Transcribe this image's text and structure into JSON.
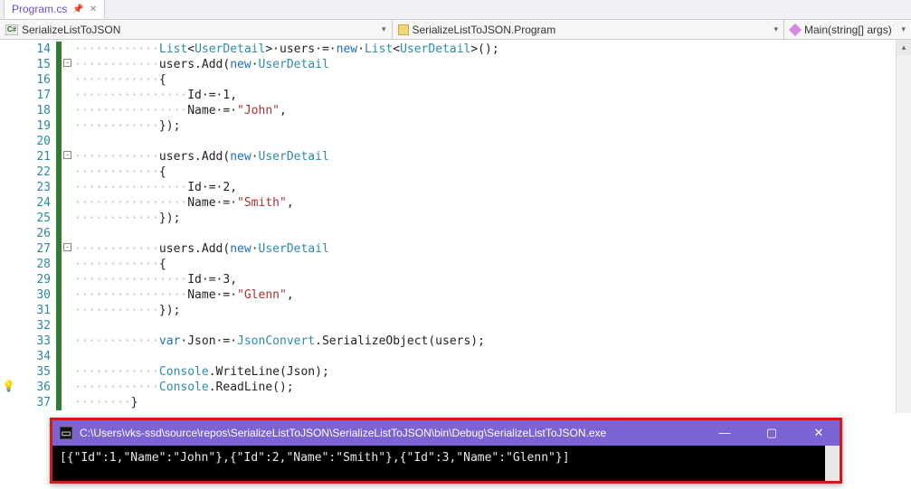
{
  "tab": {
    "filename": "Program.cs"
  },
  "context": {
    "namespace": "SerializeListToJSON",
    "class": "SerializeListToJSON.Program",
    "method": "Main(string[] args)"
  },
  "line_numbers": [
    "14",
    "15",
    "16",
    "17",
    "18",
    "19",
    "20",
    "21",
    "22",
    "23",
    "24",
    "25",
    "26",
    "27",
    "28",
    "29",
    "30",
    "31",
    "32",
    "33",
    "34",
    "35",
    "36",
    "37"
  ],
  "fold_lines": {
    "15": "-",
    "21": "-",
    "27": "-"
  },
  "lightbulb_line": "36",
  "code": {
    "l14": {
      "dots": "············",
      "a": "List",
      "b": "<",
      "c": "UserDetail",
      "d": ">·users·=·",
      "e": "new",
      "f": "·",
      "g": "List",
      "h": "<",
      "i": "UserDetail",
      "j": ">();"
    },
    "l15": {
      "dots": "············",
      "a": "users.Add(",
      "b": "new",
      "c": "·",
      "d": "UserDetail"
    },
    "l16": {
      "dots": "············",
      "a": "{"
    },
    "l17": {
      "dots": "················",
      "a": "Id·=·1,"
    },
    "l18": {
      "dots": "················",
      "a": "Name·=·",
      "b": "\"John\"",
      "c": ","
    },
    "l19": {
      "dots": "············",
      "a": "});"
    },
    "l20": {
      "dots": ""
    },
    "l21": {
      "dots": "············",
      "a": "users.Add(",
      "b": "new",
      "c": "·",
      "d": "UserDetail"
    },
    "l22": {
      "dots": "············",
      "a": "{"
    },
    "l23": {
      "dots": "················",
      "a": "Id·=·2,"
    },
    "l24": {
      "dots": "················",
      "a": "Name·=·",
      "b": "\"Smith\"",
      "c": ","
    },
    "l25": {
      "dots": "············",
      "a": "});"
    },
    "l26": {
      "dots": ""
    },
    "l27": {
      "dots": "············",
      "a": "users.Add(",
      "b": "new",
      "c": "·",
      "d": "UserDetail"
    },
    "l28": {
      "dots": "············",
      "a": "{"
    },
    "l29": {
      "dots": "················",
      "a": "Id·=·3,"
    },
    "l30": {
      "dots": "················",
      "a": "Name·=·",
      "b": "\"Glenn\"",
      "c": ","
    },
    "l31": {
      "dots": "············",
      "a": "});"
    },
    "l32": {
      "dots": ""
    },
    "l33": {
      "dots": "············",
      "a": "var",
      "b": "·Json·=·",
      "c": "JsonConvert",
      "d": ".SerializeObject(users);"
    },
    "l34": {
      "dots": ""
    },
    "l35": {
      "dots": "············",
      "a": "Console",
      "b": ".WriteLine(Json);"
    },
    "l36": {
      "dots": "············",
      "a": "Console",
      "b": ".ReadLine();"
    },
    "l37": {
      "dots": "········",
      "a": "}"
    }
  },
  "console": {
    "title": "C:\\Users\\vks-ssd\\source\\repos\\SerializeListToJSON\\SerializeListToJSON\\bin\\Debug\\SerializeListToJSON.exe",
    "output": "[{\"Id\":1,\"Name\":\"John\"},{\"Id\":2,\"Name\":\"Smith\"},{\"Id\":3,\"Name\":\"Glenn\"}]"
  },
  "window_buttons": {
    "min": "—",
    "max": "▢",
    "close": "✕"
  }
}
